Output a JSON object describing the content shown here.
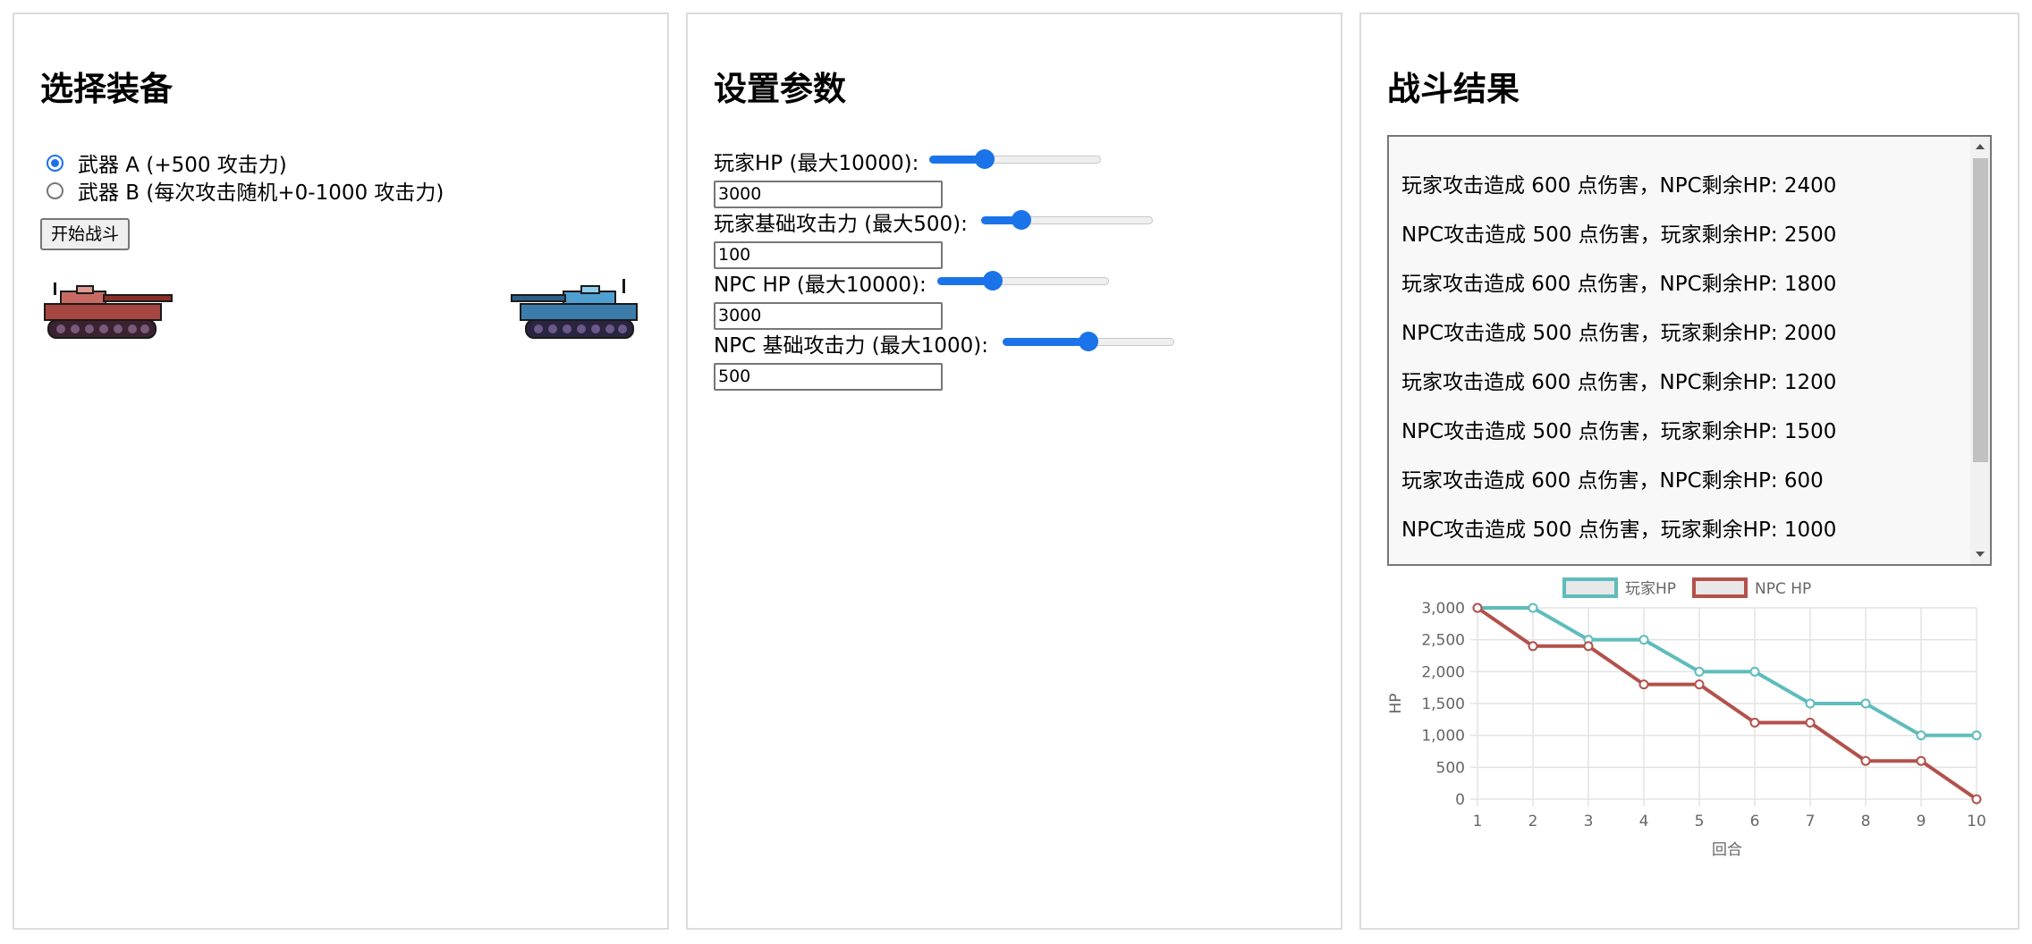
{
  "panel_equipment": {
    "title": "选择装备",
    "weapons": [
      {
        "label": "武器 A (+500 攻击力)",
        "selected": true
      },
      {
        "label": "武器 B (每次攻击随机+0-1000 攻击力)",
        "selected": false
      }
    ],
    "start_button": "开始战斗",
    "player_tank_icon": "red-tank-icon",
    "npc_tank_icon": "blue-tank-icon"
  },
  "panel_params": {
    "title": "设置参数",
    "params": [
      {
        "label": "玩家HP (最大10000):",
        "value": "3000",
        "max": 10000
      },
      {
        "label": "玩家基础攻击力 (最大500):",
        "value": "100",
        "max": 500
      },
      {
        "label": "NPC HP (最大10000):",
        "value": "3000",
        "max": 10000
      },
      {
        "label": "NPC 基础攻击力 (最大1000):",
        "value": "500",
        "max": 1000
      }
    ]
  },
  "panel_result": {
    "title": "战斗结果",
    "log": [
      "玩家攻击造成 600 点伤害，NPC剩余HP: 2400",
      "NPC攻击造成 500 点伤害，玩家剩余HP: 2500",
      "玩家攻击造成 600 点伤害，NPC剩余HP: 1800",
      "NPC攻击造成 500 点伤害，玩家剩余HP: 2000",
      "玩家攻击造成 600 点伤害，NPC剩余HP: 1200",
      "NPC攻击造成 500 点伤害，玩家剩余HP: 1500",
      "玩家攻击造成 600 点伤害，NPC剩余HP: 600",
      "NPC攻击造成 500 点伤害，玩家剩余HP: 1000"
    ]
  },
  "chart_data": {
    "type": "line",
    "categories": [
      "1",
      "2",
      "3",
      "4",
      "5",
      "6",
      "7",
      "8",
      "9",
      "10"
    ],
    "series": [
      {
        "name": "玩家HP",
        "color": "#5fbcbc",
        "values": [
          3000,
          3000,
          2500,
          2500,
          2000,
          2000,
          1500,
          1500,
          1000,
          1000
        ]
      },
      {
        "name": "NPC HP",
        "color": "#b3514b",
        "values": [
          3000,
          2400,
          2400,
          1800,
          1800,
          1200,
          1200,
          600,
          600,
          0
        ]
      }
    ],
    "xlabel": "回合",
    "ylabel": "HP",
    "ylim": [
      0,
      3000
    ],
    "yticks": [
      "0",
      "500",
      "1,000",
      "1,500",
      "2,000",
      "2,500",
      "3,000"
    ],
    "grid": true,
    "legend": "top"
  }
}
